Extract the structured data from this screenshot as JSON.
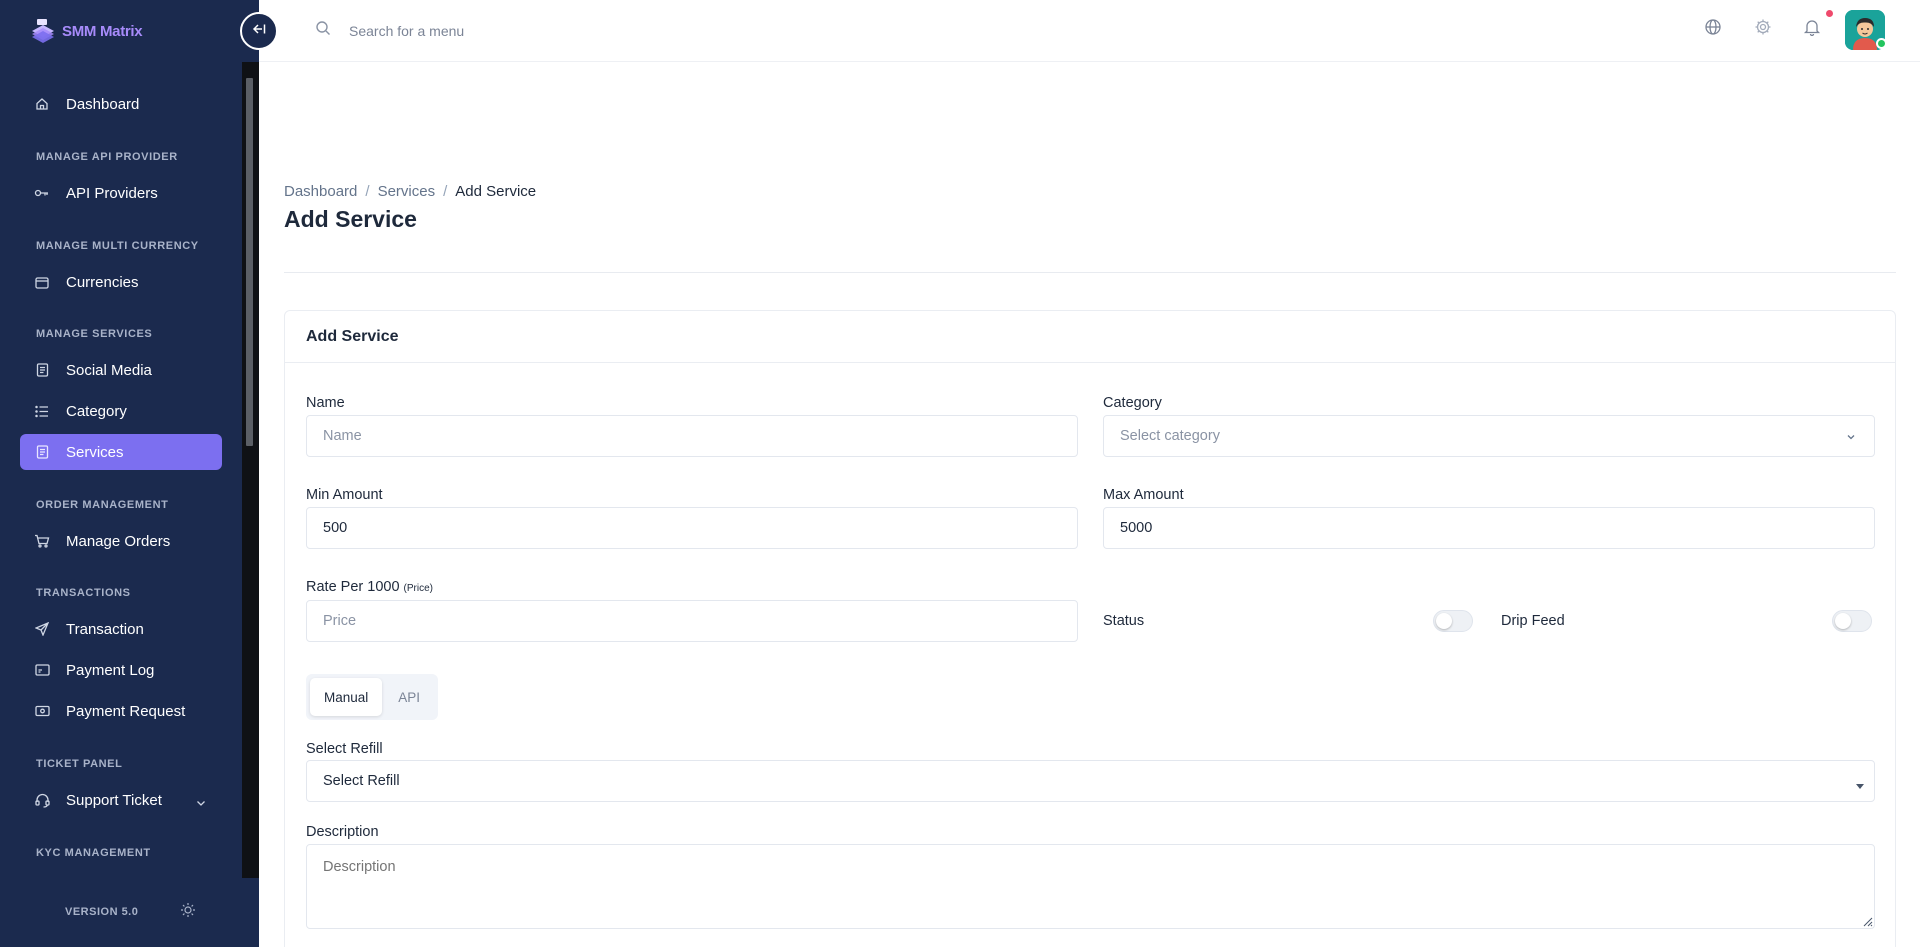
{
  "brand": {
    "name": "SMM Matrix"
  },
  "search": {
    "placeholder": "Search for a menu"
  },
  "sidebar": {
    "items": [
      {
        "label": "Dashboard",
        "icon": "home-icon"
      },
      {
        "section": "MANAGE API PROVIDER"
      },
      {
        "label": "API Providers",
        "icon": "key-icon"
      },
      {
        "section": "MANAGE MULTI CURRENCY"
      },
      {
        "label": "Currencies",
        "icon": "wallet-icon"
      },
      {
        "section": "MANAGE SERVICES"
      },
      {
        "label": "Social Media",
        "icon": "document-icon"
      },
      {
        "label": "Category",
        "icon": "list-icon"
      },
      {
        "label": "Services",
        "icon": "document-icon",
        "active": true
      },
      {
        "section": "ORDER MANAGEMENT"
      },
      {
        "label": "Manage Orders",
        "icon": "cart-icon"
      },
      {
        "section": "TRANSACTIONS"
      },
      {
        "label": "Transaction",
        "icon": "send-icon"
      },
      {
        "label": "Payment Log",
        "icon": "card-icon"
      },
      {
        "label": "Payment Request",
        "icon": "cash-icon"
      },
      {
        "section": "TICKET PANEL"
      },
      {
        "label": "Support Ticket",
        "icon": "headset-icon"
      },
      {
        "section": "KYC MANAGEMENT"
      }
    ],
    "version": "VERSION 5.0"
  },
  "breadcrumb": {
    "home": "Dashboard",
    "parent": "Services",
    "current": "Add Service",
    "sep": "/"
  },
  "page": {
    "title": "Add Service"
  },
  "form": {
    "card_title": "Add Service",
    "name": {
      "label": "Name",
      "placeholder": "Name"
    },
    "category": {
      "label": "Category",
      "placeholder": "Select category"
    },
    "min_amount": {
      "label": "Min Amount",
      "value": "500"
    },
    "max_amount": {
      "label": "Max Amount",
      "value": "5000"
    },
    "rate": {
      "label": "Rate Per 1000",
      "hint": "(Price)",
      "placeholder": "Price"
    },
    "status": {
      "label": "Status",
      "enabled": false
    },
    "drip_feed": {
      "label": "Drip Feed",
      "enabled": false
    },
    "tabs": [
      {
        "label": "Manual",
        "active": true
      },
      {
        "label": "API",
        "active": false
      }
    ],
    "refill": {
      "label": "Select Refill",
      "value": "Select Refill"
    },
    "description": {
      "label": "Description",
      "placeholder": "Description"
    }
  },
  "colors": {
    "sidebar": "#1b2a4e",
    "accent": "#7c6ff0",
    "brand": "#a78bfa",
    "notification": "#ef4a6c",
    "online": "#22c55e"
  }
}
